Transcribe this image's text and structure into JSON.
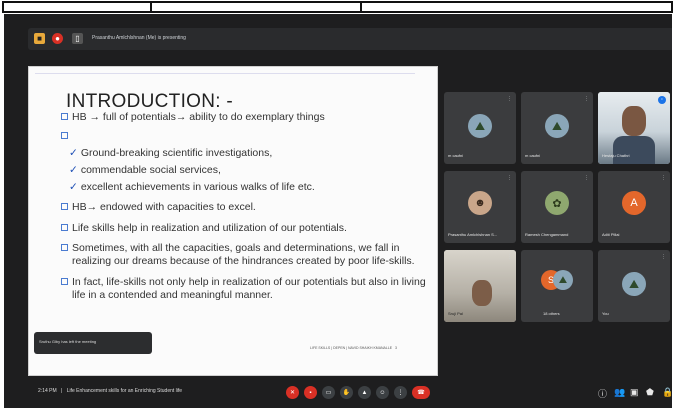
{
  "presenting_bar": {
    "text": "Prasanthu Amlchlshnan (Me) is presenting"
  },
  "slide": {
    "title": "INTRODUCTION: -",
    "bullets": [
      "HB → full of potentials→ ability to do exemplary things",
      "",
      "Ground-breaking scientific investigations,",
      "commendable social services,",
      "excellent achievements in various walks of life  etc.",
      "HB→ endowed with capacities to excel.",
      "Life skills help in realization and utilization of our potentials.",
      "Sometimes, with all the capacities, goals and determinations, we fall in",
      "realizing our dreams because of the hindrances created by poor life-skills.",
      "In fact, life-skills not only help in realization of our potentials but also in living",
      "life in a contended and meaningful manner."
    ],
    "footer": "LIFE SKILLS | DEPEN | NAVID SHAIKH KMANALLE",
    "page_number": "3"
  },
  "toast": {
    "text": "Sruthu Glby has left the meeting"
  },
  "participants": [
    {
      "name": "m caufni"
    },
    {
      "name": "m caufni"
    },
    {
      "name": "Hestaju Chathri"
    },
    {
      "name": "Prasanthu Amlchlshnan S..."
    },
    {
      "name": "Ramesh Chengammand"
    },
    {
      "name": "Aditi Pillai",
      "initial": "A"
    },
    {
      "name": "Sruji Pal"
    },
    {
      "name": "18 others",
      "initial": "S"
    },
    {
      "name": "You"
    }
  ],
  "bottom_bar": {
    "time": "2:14 PM",
    "separator": "|",
    "meeting_title": "Life Enhancement skills for an Enriching Student life"
  },
  "colors": {
    "red": "#d93025",
    "bg": "#1e1e1f",
    "tile": "#3b3c3e",
    "orange": "#e3672b"
  }
}
